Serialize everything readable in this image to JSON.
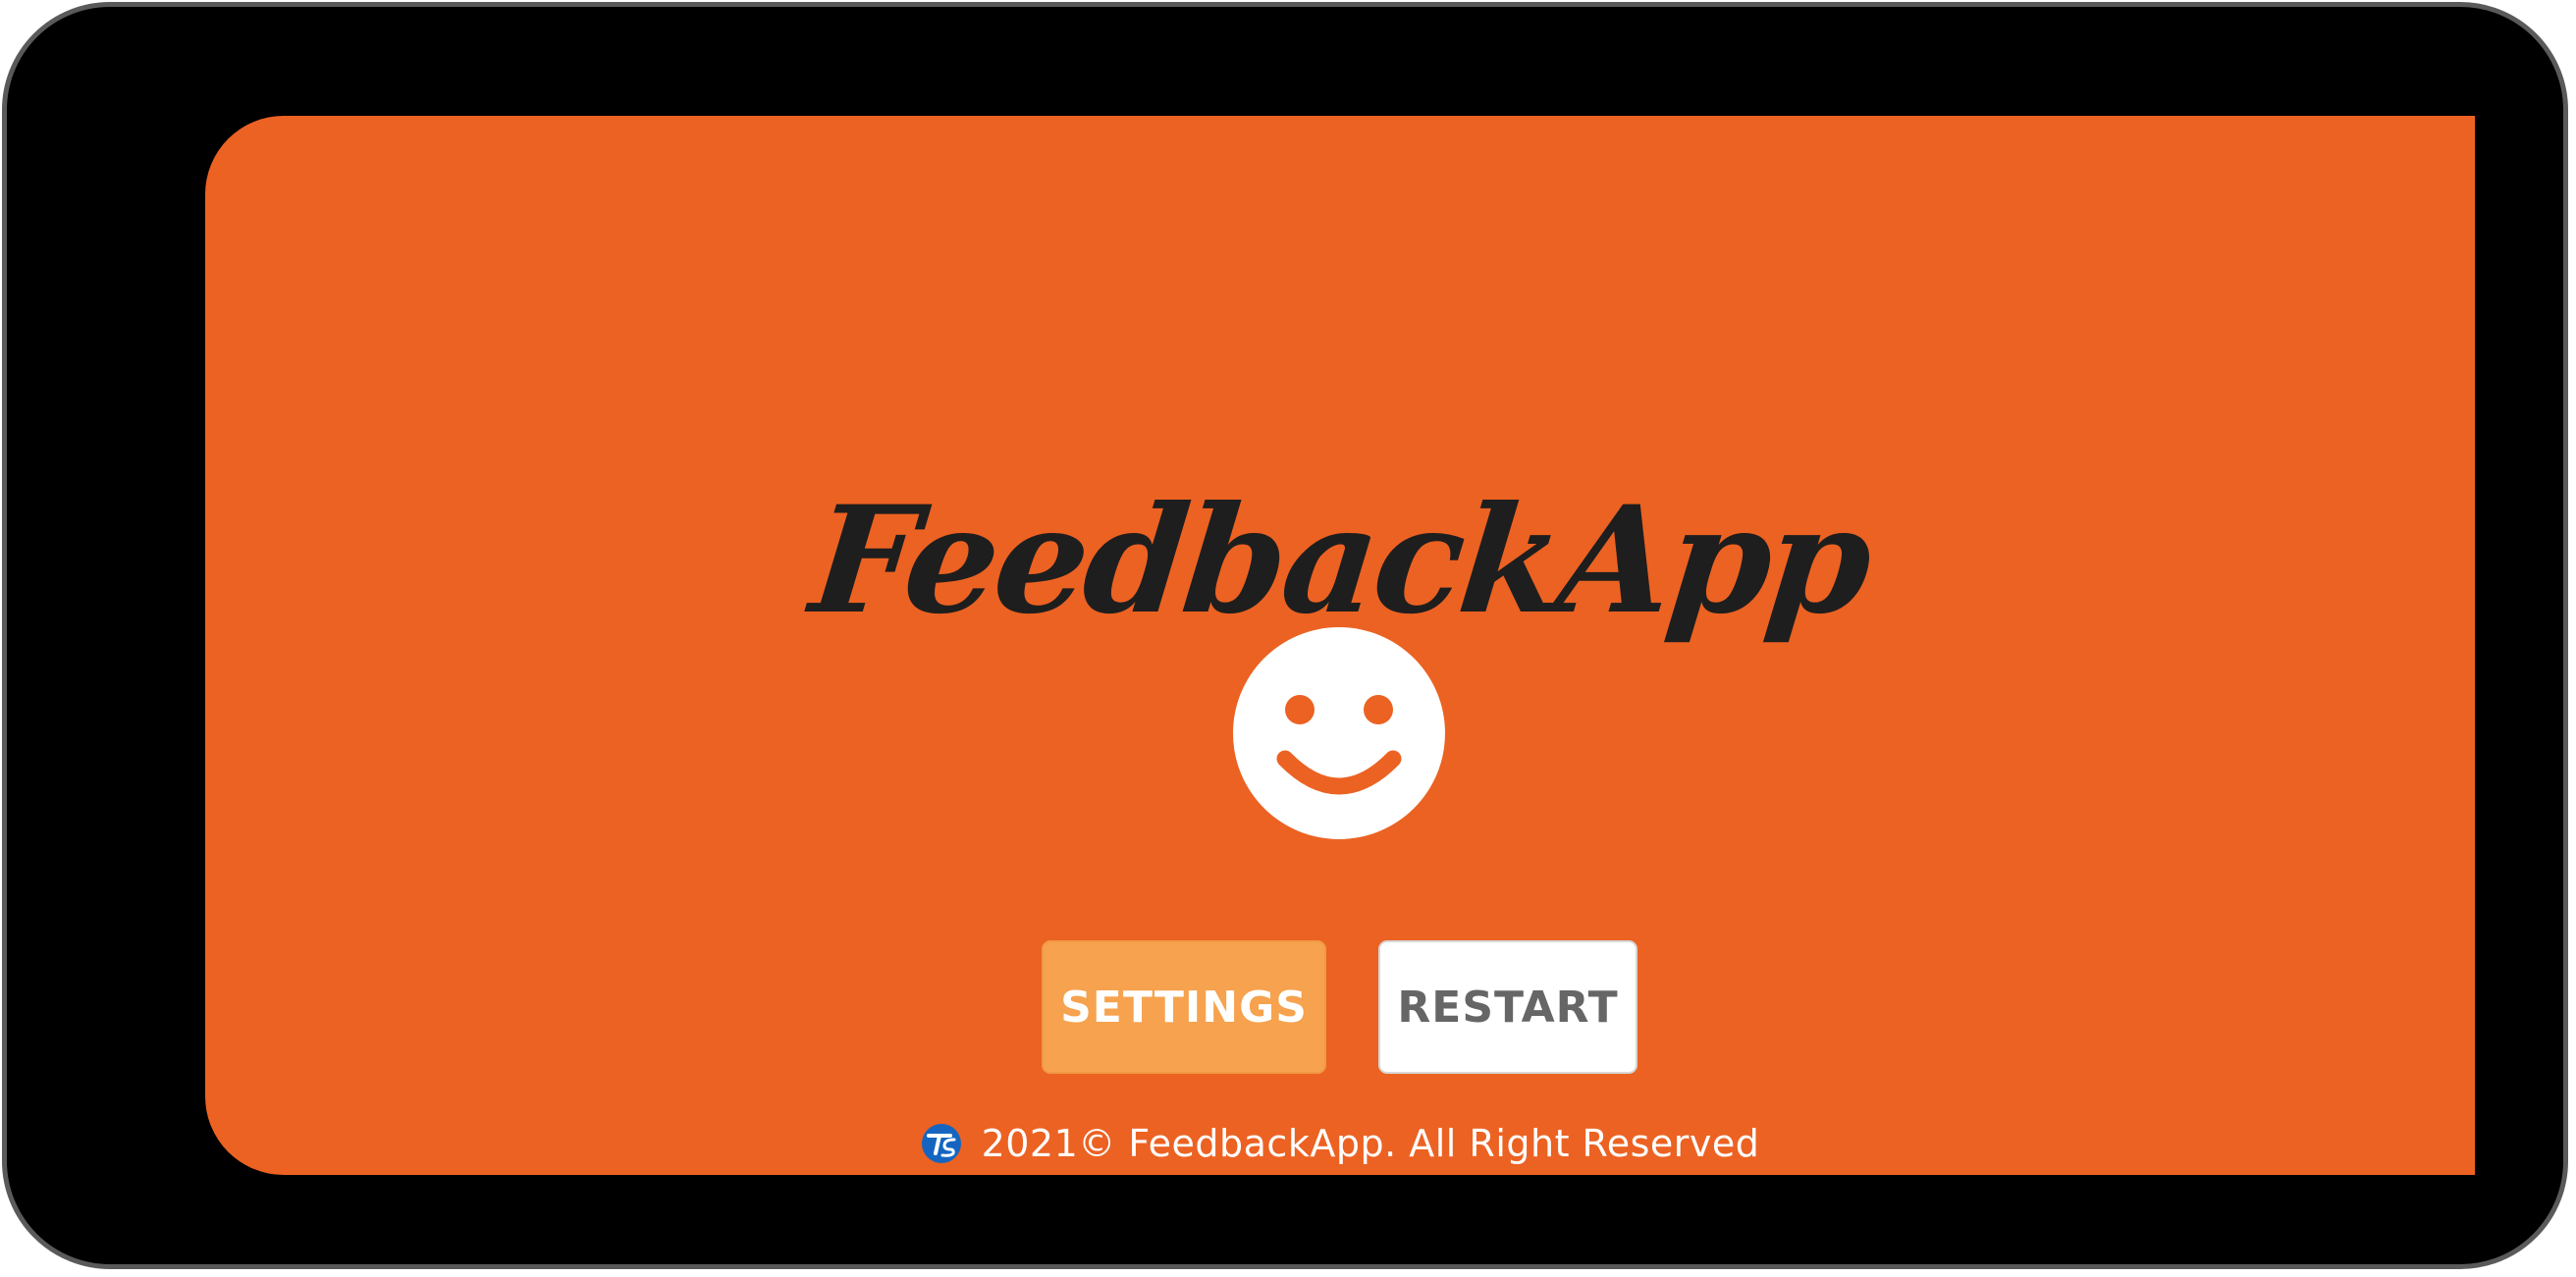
{
  "app": {
    "title": "FeedbackApp"
  },
  "icons": {
    "main": "smiley-face-icon",
    "footer": "company-logo-icon"
  },
  "buttons": {
    "settings_label": "SETTINGS",
    "restart_label": "RESTART"
  },
  "footer": {
    "text": "2021© FeedbackApp. All Right Reserved"
  },
  "colors": {
    "background": "#EC6222",
    "settings_button": "#F6A24E",
    "restart_button": "#FFFFFF",
    "title": "#1E1E1E",
    "logo": "#1565C0"
  }
}
